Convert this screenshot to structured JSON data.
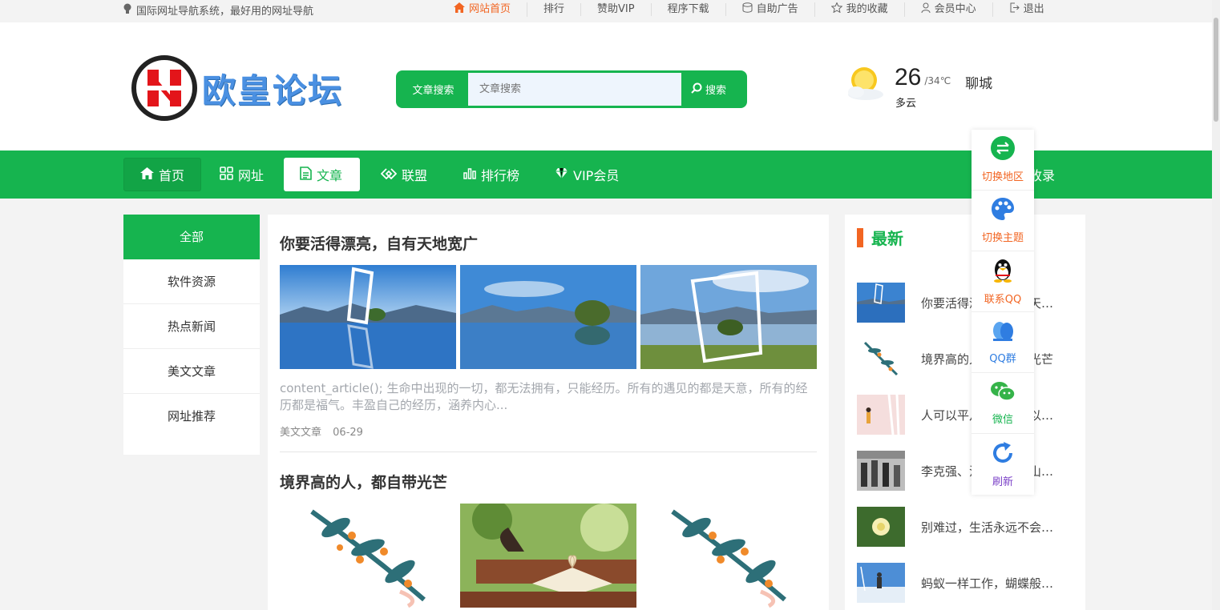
{
  "topbar": {
    "slogan": "国际网址导航系统，最好用的网址导航",
    "links": [
      {
        "label": "网站首页",
        "icon": "home-icon",
        "active": true
      },
      {
        "label": "排行",
        "icon": ""
      },
      {
        "label": "赞助VIP",
        "icon": ""
      },
      {
        "label": "程序下载",
        "icon": ""
      },
      {
        "label": "自助广告",
        "icon": "ad-icon"
      },
      {
        "label": "我的收藏",
        "icon": "star-icon"
      },
      {
        "label": "会员中心",
        "icon": "user-icon"
      },
      {
        "label": "退出",
        "icon": "logout-icon"
      }
    ]
  },
  "header": {
    "logo_text": "欧皇论坛",
    "search": {
      "label": "文章搜索",
      "placeholder": "文章搜索",
      "button": "搜索"
    },
    "weather": {
      "temp": "26",
      "range": "/34℃",
      "city": "聊城",
      "desc": "多云"
    }
  },
  "nav": {
    "items": [
      {
        "label": "首页",
        "icon": "home-icon"
      },
      {
        "label": "网址",
        "icon": "grid-icon"
      },
      {
        "label": "文章",
        "icon": "document-icon",
        "active": true
      },
      {
        "label": "联盟",
        "icon": "link-icon"
      },
      {
        "label": "排行榜",
        "icon": "chart-icon"
      },
      {
        "label": "VIP会员",
        "icon": "diamond-icon"
      }
    ],
    "right_label": "收录"
  },
  "categories": [
    "全部",
    "软件资源",
    "热点新闻",
    "美文文章",
    "网址推荐"
  ],
  "posts": [
    {
      "title": "你要活得漂亮，自有天地宽广",
      "excerpt": "content_article();                生命中出现的一切，都无法拥有，只能经历。所有的遇见的都是天意，所有的经历都是福气。丰盈自己的经历，涵养内心...",
      "category": "美文文章",
      "date": "06-29"
    },
    {
      "title": "境界高的人，都自带光芒"
    }
  ],
  "latest": {
    "title": "最新",
    "items": [
      "你要活得漂亮，自有天…",
      "境界高的人，都自带光芒",
      "人可以平凡，但不可以…",
      "李克强、汪洋、王岐山、李毅…",
      "别难过，生活永远不会…",
      "蚂蚁一样工作，蝴蝶般…"
    ]
  },
  "float_panel": [
    {
      "label": "切换地区",
      "color": "#f26522"
    },
    {
      "label": "切换主题",
      "color": "#f26522"
    },
    {
      "label": "联系QQ",
      "color": "#f26522"
    },
    {
      "label": "QQ群",
      "color": "#2f7de1"
    },
    {
      "label": "微信",
      "color": "#16b44f"
    },
    {
      "label": "刷新",
      "color": "#7a3fc7"
    }
  ],
  "colors": {
    "brand": "#16b44f",
    "accent": "#f26522"
  }
}
